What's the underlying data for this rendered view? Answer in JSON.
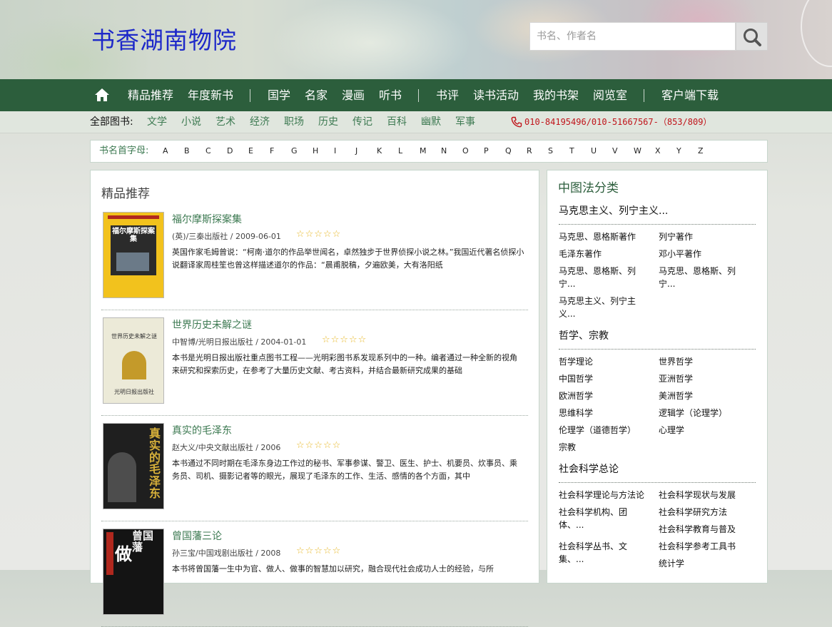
{
  "header": {
    "site_title": "书香湖南物院",
    "search_placeholder": "书名、作者名"
  },
  "nav": {
    "items": [
      "精品推荐",
      "年度新书",
      "国学",
      "名家",
      "漫画",
      "听书",
      "书评",
      "读书活动",
      "我的书架",
      "阅览室",
      "客户端下载"
    ],
    "background_color": "#2c5e3c"
  },
  "subnav": {
    "label": "全部图书:",
    "categories": [
      "文学",
      "小说",
      "艺术",
      "经济",
      "职场",
      "历史",
      "传记",
      "百科",
      "幽默",
      "军事"
    ],
    "phone": "010-84195496/010-51667567-（853/809）",
    "link_color": "#3d7a52",
    "phone_color": "#c0141a"
  },
  "alpha": {
    "label": "书名首字母:",
    "letters": [
      "A",
      "B",
      "C",
      "D",
      "E",
      "F",
      "G",
      "H",
      "I",
      "J",
      "K",
      "L",
      "M",
      "N",
      "O",
      "P",
      "Q",
      "R",
      "S",
      "T",
      "U",
      "V",
      "W",
      "X",
      "Y",
      "Z"
    ]
  },
  "main": {
    "section_title": "精品推荐",
    "books": [
      {
        "title": "福尔摩斯探案集",
        "meta": "(英)/三秦出版社 / 2009-06-01",
        "stars": "☆☆☆☆☆",
        "desc": "英国作家毛姆曾说：“柯南·道尔的作品举世闻名，卓然独步于世界侦探小说之林。”我国近代著名侦探小说翻译家周桂笙也曾这样描述道尔的作品：“晨甫脱稿，夕遍欧美，大有洛阳纸"
      },
      {
        "title": "世界历史未解之谜",
        "meta": "中智博/光明日报出版社 / 2004-01-01",
        "stars": "☆☆☆☆☆",
        "desc": "本书是光明日报出版社重点图书工程——光明彩图书系发现系列中的一种。编者通过一种全新的视角来研究和探索历史，在参考了大量历史文献、考古资料，并结合最新研究成果的基础"
      },
      {
        "title": "真实的毛泽东",
        "meta": "赵大义/中央文献出版社 / 2006",
        "stars": "☆☆☆☆☆",
        "desc": "本书通过不同时期在毛泽东身边工作过的秘书、军事参谋、警卫、医生、护士、机要员、炊事员、乘务员、司机、摄影记者等的眼光，展现了毛泽东的工作、生活、感情的各个方面，其中"
      },
      {
        "title": "曾国藩三论",
        "meta": "孙三宝/中国戏剧出版社 / 2008",
        "stars": "☆☆☆☆☆",
        "desc": "本书将曾国藩一生中为官、做人、做事的智慧加以研究，融合现代社会成功人士的经验，与所"
      }
    ],
    "covers": {
      "book1_text": "福尔摩斯探案集",
      "book2_text": "世界历史未解之谜",
      "book2_publisher": "光明日报出版社",
      "book3_text": "真实的毛泽东",
      "book4_text": "曾国藩",
      "book4_char": "做"
    }
  },
  "sidebar": {
    "title": "中图法分类",
    "groups": [
      {
        "name": "马克思主义、列宁主义...",
        "links": [
          "马克思、恩格斯著作",
          "列宁著作",
          "毛泽东著作",
          "邓小平著作",
          "马克思、恩格斯、列宁...",
          "马克思、恩格斯、列宁...",
          "马克思主义、列宁主义..."
        ]
      },
      {
        "name": "哲学、宗教",
        "links": [
          "哲学理论",
          "世界哲学",
          "中国哲学",
          "亚洲哲学",
          "欧洲哲学",
          "美洲哲学",
          "思维科学",
          "逻辑学（论理学）",
          "伦理学（道德哲学）",
          "心理学",
          "宗教"
        ]
      },
      {
        "name": "社会科学总论",
        "links": [
          "社会科学理论与方法论",
          "社会科学现状与发展",
          "社会科学机构、团体、...",
          "社会科学研究方法",
          "社会科学教育与普及",
          "社会科学丛书、文集、...",
          "社会科学参考工具书",
          "统计学"
        ]
      }
    ]
  }
}
